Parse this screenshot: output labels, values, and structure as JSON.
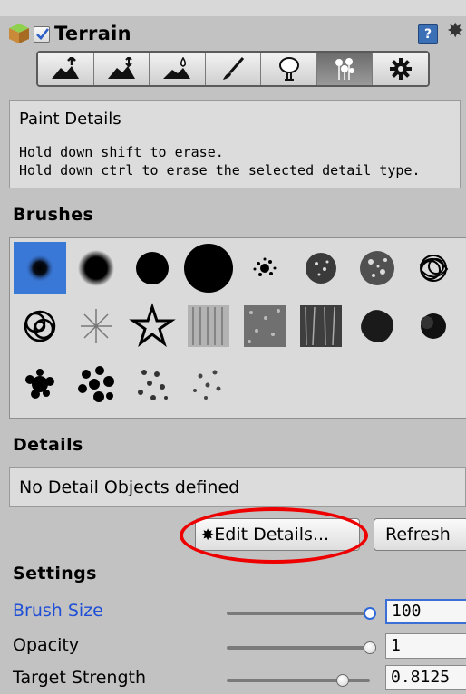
{
  "header": {
    "title": "Terrain",
    "enabled": true,
    "help_icon_glyph": "?",
    "settings_icon_glyph": "✸"
  },
  "toolbar": {
    "tools": [
      {
        "name": "raise-lower-terrain",
        "icon": "mountain-up-arrow-icon"
      },
      {
        "name": "paint-height",
        "icon": "mountain-arrow-icon"
      },
      {
        "name": "smooth-height",
        "icon": "mountain-drop-icon"
      },
      {
        "name": "paint-texture",
        "icon": "brush-icon"
      },
      {
        "name": "place-trees",
        "icon": "tree-icon"
      },
      {
        "name": "paint-details",
        "icon": "flowers-icon",
        "active": true
      },
      {
        "name": "terrain-settings",
        "icon": "gear-icon"
      }
    ]
  },
  "info": {
    "title": "Paint Details",
    "line1": "Hold down shift to erase.",
    "line2": "Hold down ctrl to erase the selected detail type."
  },
  "brushes": {
    "heading": "Brushes",
    "selected_index": 0,
    "count": 20
  },
  "details": {
    "heading": "Details",
    "empty_text": "No Detail Objects defined",
    "edit_button": "Edit Details...",
    "edit_button_icon": "✸",
    "refresh_button": "Refresh"
  },
  "settings": {
    "heading": "Settings",
    "brush_size": {
      "label": "Brush Size",
      "value": "100",
      "fraction": 1.0
    },
    "opacity": {
      "label": "Opacity",
      "value": "1",
      "fraction": 1.0
    },
    "target_strength": {
      "label": "Target Strength",
      "value": "0.8125",
      "fraction": 0.8125
    }
  },
  "colors": {
    "selection_blue": "#3a78d8",
    "highlight_red": "#e00000",
    "label_blue": "#1f4fd6"
  }
}
